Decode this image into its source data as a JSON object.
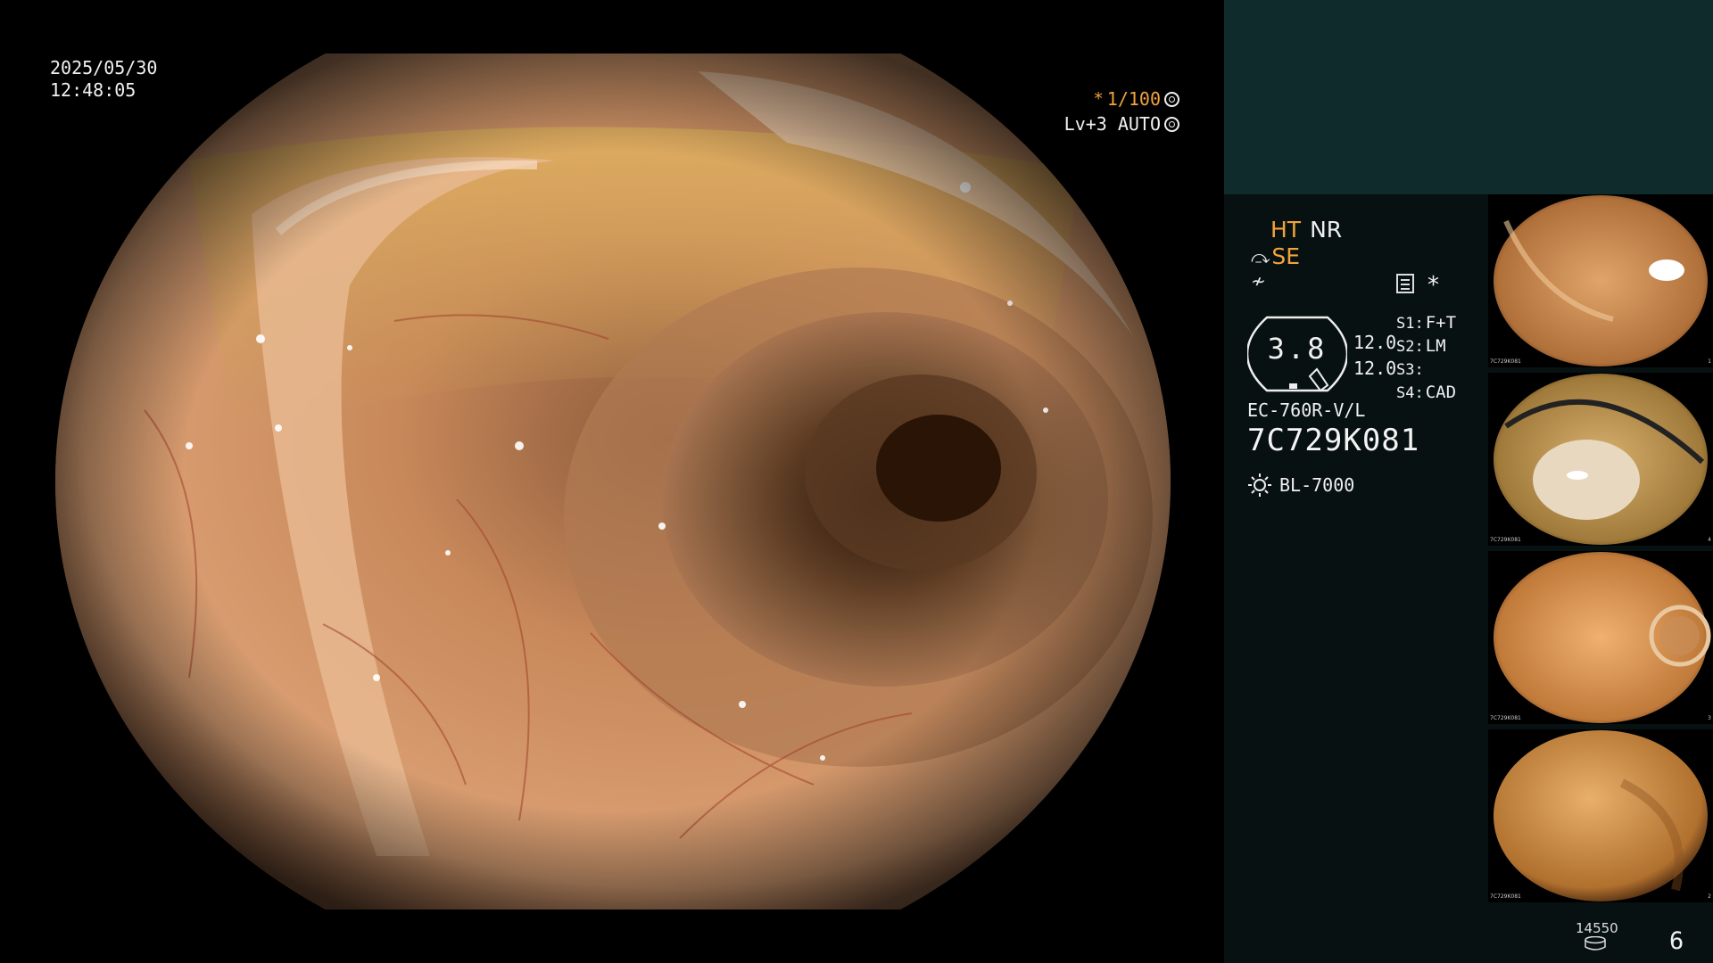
{
  "datetime": {
    "date": "2025/05/30",
    "time": "12:48:05"
  },
  "overlay": {
    "shutter_label": "1/100",
    "shutter_symbol": "*",
    "iris_label": "Lv+3",
    "mode_label": "AUTO"
  },
  "status": {
    "ht": "HT",
    "nr": "NR",
    "se": "SE",
    "star": "*",
    "gauge_value": "3.8",
    "values": [
      "12.0",
      "12.0"
    ],
    "switches": [
      {
        "key": "S1:",
        "value": "F+T"
      },
      {
        "key": "S2:",
        "value": "LM"
      },
      {
        "key": "S3:",
        "value": ""
      },
      {
        "key": "S4:",
        "value": "CAD"
      }
    ],
    "scope_model": "EC-760R-V/L",
    "scope_serial": "7C729K081",
    "light_source": "BL-7000"
  },
  "thumbnails": [
    {
      "label": "7C729K081",
      "index": "1"
    },
    {
      "label": "7C729K081",
      "index": "4"
    },
    {
      "label": "7C729K081",
      "index": "3"
    },
    {
      "label": "7C729K081",
      "index": "2"
    }
  ],
  "footer": {
    "count": "14550",
    "page": "6"
  },
  "icons": [
    "shutter-icon",
    "auto-iris-icon",
    "filter-icon",
    "sun-icon",
    "disk-icon"
  ],
  "colors": {
    "accent": "#f2a33a",
    "panel_top": "#0f2b2b",
    "panel": "#081111"
  }
}
